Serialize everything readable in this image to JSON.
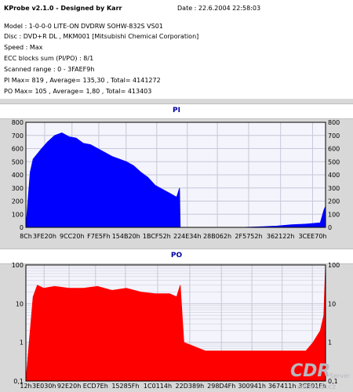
{
  "info": {
    "title": "KProbe v2.1.0 - Designed by Karr",
    "date": "Date : 22.6.2004 22:58:03",
    "lines": [
      "Model : 1-0-0-0 LITE-ON DVDRW SOHW-832S  VS01",
      "Disc : DVD+R DL , MKM001 [Mitsubishi Chemical Corporation]",
      "Speed : Max",
      "ECC blocks sum (PI/PO) : 8/1",
      "Scanned range : 0 - 3FAEF9h",
      "PI Max= 819 , Average= 135,30 , Total= 4141272",
      "PO Max= 105 , Average= 1,80 , Total= 413403"
    ]
  },
  "watermark": "CDR Server www.cdr.cz",
  "colors": {
    "pi": "#0000ff",
    "po": "#ff0000",
    "plot_bg": "#f4f4fc",
    "panel_bg": "#d8d8d8",
    "grid": "#c8c8d8",
    "title": "#0000a0"
  },
  "chart_data": [
    {
      "type": "area",
      "title": "PI",
      "scale": "linear",
      "ylim": [
        0,
        800
      ],
      "yticks": [
        0,
        100,
        200,
        300,
        400,
        500,
        600,
        700,
        800
      ],
      "ytick_labels": [
        "0",
        "100",
        "200",
        "300",
        "400",
        "500",
        "600",
        "700",
        "800"
      ],
      "xlim": [
        0,
        4173561
      ],
      "xtick_labels": [
        "8Ch",
        "3FE20h",
        "9CC20h",
        "F7E5Fh",
        "154B20h",
        "1BCF52h",
        "224E34h",
        "28B062h",
        "2F5752h",
        "362122h",
        "3CEE70h"
      ],
      "xtick_positions": [
        140,
        261152,
        642080,
        1015391,
        1395488,
        1822546,
        2248244,
        2666594,
        3102546,
        3547426,
        3993200
      ],
      "grid": true,
      "series": [
        {
          "name": "PI",
          "color": "#0000ff",
          "x": [
            0,
            60000,
            100000,
            160000,
            220000,
            300000,
            400000,
            500000,
            600000,
            700000,
            800000,
            900000,
            1000000,
            1100000,
            1200000,
            1300000,
            1400000,
            1500000,
            1600000,
            1700000,
            1800000,
            1900000,
            2000000,
            2100000,
            2140000,
            2150000,
            2500000,
            3000000,
            3300000,
            3500000,
            3700000,
            3900000,
            4000000,
            4100000,
            4150000,
            4173561
          ],
          "y": [
            0,
            420,
            520,
            560,
            600,
            650,
            700,
            720,
            690,
            680,
            640,
            630,
            600,
            570,
            540,
            520,
            500,
            470,
            420,
            380,
            320,
            290,
            260,
            230,
            300,
            0,
            0,
            0,
            5,
            10,
            20,
            25,
            30,
            35,
            130,
            160
          ]
        }
      ]
    },
    {
      "type": "area",
      "title": "PO",
      "scale": "log",
      "ylim": [
        0.1,
        100
      ],
      "yticks": [
        0.1,
        1,
        10,
        100
      ],
      "ytick_labels": [
        "0,1",
        "1",
        "10",
        "100"
      ],
      "xlim": [
        0,
        4173561
      ],
      "xtick_labels": [
        "12h",
        "3E030h",
        "92E20h",
        "ECD7Eh",
        "15285Fh",
        "1C0114h",
        "22D389h",
        "298D4Fh",
        "300941h",
        "367411h",
        "3CE01Fh"
      ],
      "xtick_positions": [
        18,
        254000,
        601632,
        970110,
        1386591,
        1835284,
        2282377,
        2723151,
        3148097,
        3568657,
        3989535
      ],
      "grid": true,
      "series": [
        {
          "name": "PO",
          "color": "#ff0000",
          "x": [
            0,
            60000,
            100000,
            160000,
            250000,
            400000,
            600000,
            800000,
            1000000,
            1200000,
            1400000,
            1600000,
            1800000,
            2000000,
            2100000,
            2150000,
            2200000,
            2500000,
            2800000,
            3100000,
            3400000,
            3700000,
            3900000,
            4000000,
            4100000,
            4150000,
            4173561
          ],
          "y": [
            0.1,
            2,
            15,
            30,
            25,
            28,
            25,
            25,
            28,
            22,
            25,
            20,
            18,
            18,
            15,
            30,
            1,
            0.6,
            0.6,
            0.6,
            0.6,
            0.6,
            0.6,
            1,
            2,
            5,
            100
          ]
        }
      ]
    }
  ]
}
